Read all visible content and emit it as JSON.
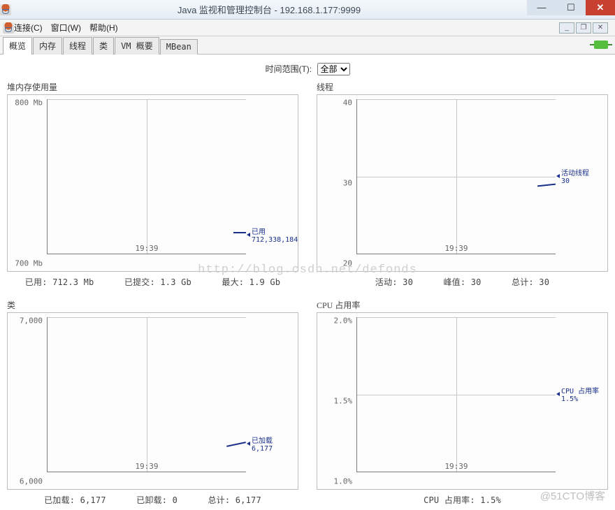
{
  "window": {
    "title": "Java 监视和管理控制台 - 192.168.1.177:9999"
  },
  "menubar": {
    "items": [
      "连接(C)",
      "窗口(W)",
      "帮助(H)"
    ]
  },
  "tabs": [
    "概览",
    "内存",
    "线程",
    "类",
    "VM 概要",
    "MBean"
  ],
  "active_tab_index": 0,
  "time_range": {
    "label": "时间范围(T):",
    "value": "全部"
  },
  "panels": {
    "heap": {
      "title": "堆内存使用量",
      "ylabels": [
        "800 Mb",
        "700 Mb"
      ],
      "xtick": "19:39",
      "marker": {
        "title": "已用",
        "value": "712,338,184"
      },
      "stats": [
        {
          "k": "已用:",
          "v": "712.3  Mb"
        },
        {
          "k": "已提交:",
          "v": "1.3  Gb"
        },
        {
          "k": "最大:",
          "v": "1.9  Gb"
        }
      ]
    },
    "threads": {
      "title": "线程",
      "ylabels": [
        "40",
        "30",
        "20"
      ],
      "xtick": "19:39",
      "marker": {
        "title": "活动线程",
        "value": "30"
      },
      "stats": [
        {
          "k": "活动:",
          "v": "30"
        },
        {
          "k": "峰值:",
          "v": "30"
        },
        {
          "k": "总计:",
          "v": "30"
        }
      ]
    },
    "classes": {
      "title": "类",
      "ylabels": [
        "7,000",
        "6,000"
      ],
      "xtick": "19:39",
      "marker": {
        "title": "已加载",
        "value": "6,177"
      },
      "stats": [
        {
          "k": "已加载:",
          "v": "6,177"
        },
        {
          "k": "已卸载:",
          "v": "0"
        },
        {
          "k": "总计:",
          "v": "6,177"
        }
      ]
    },
    "cpu": {
      "title": "CPU 占用率",
      "ylabels": [
        "2.0%",
        "1.5%",
        "1.0%"
      ],
      "xtick": "19:39",
      "marker": {
        "title": "CPU 占用率",
        "value": "1.5%"
      },
      "stats": [
        {
          "k": "CPU 占用率:",
          "v": "1.5%"
        }
      ]
    }
  },
  "watermark": "http://blog.csdn.net/defonds",
  "watermark2": "@51CTO博客",
  "chart_data": [
    {
      "type": "line",
      "title": "堆内存使用量",
      "ylabel": "Mb",
      "ylim": [
        700,
        800
      ],
      "x": [
        "19:39"
      ],
      "series": [
        {
          "name": "已用",
          "values": [
            712338184
          ]
        }
      ]
    },
    {
      "type": "line",
      "title": "线程",
      "ylabel": "",
      "ylim": [
        20,
        40
      ],
      "x": [
        "19:39"
      ],
      "series": [
        {
          "name": "活动线程",
          "values": [
            30
          ]
        }
      ]
    },
    {
      "type": "line",
      "title": "类",
      "ylabel": "",
      "ylim": [
        6000,
        7000
      ],
      "x": [
        "19:39"
      ],
      "series": [
        {
          "name": "已加载",
          "values": [
            6177
          ]
        }
      ]
    },
    {
      "type": "line",
      "title": "CPU 占用率",
      "ylabel": "%",
      "ylim": [
        1.0,
        2.0
      ],
      "x": [
        "19:39"
      ],
      "series": [
        {
          "name": "CPU 占用率",
          "values": [
            1.5
          ]
        }
      ]
    }
  ]
}
